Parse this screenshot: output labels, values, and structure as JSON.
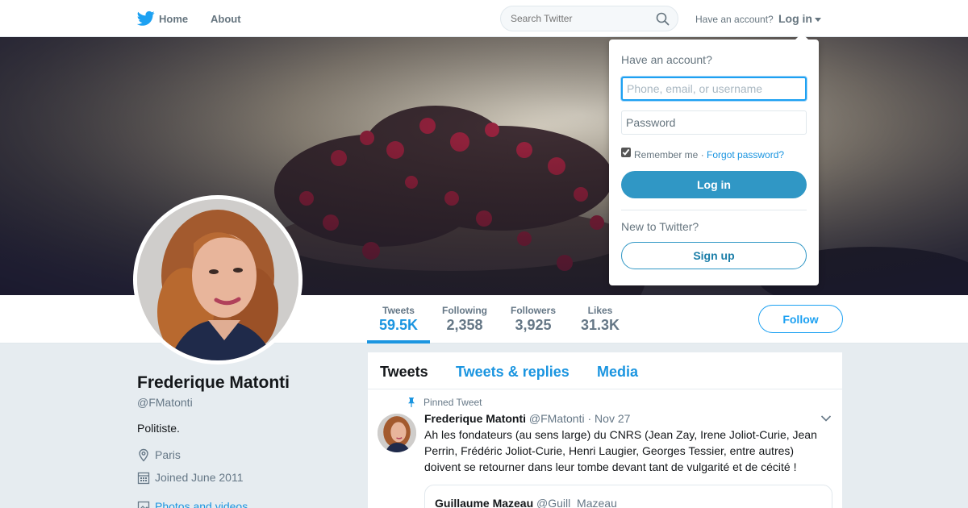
{
  "colors": {
    "brand": "#1da1f2",
    "link": "#1b95e0",
    "button": "#3097c5"
  },
  "topnav": {
    "home_label": "Home",
    "about_label": "About",
    "search_placeholder": "Search Twitter",
    "have_account": "Have an account?",
    "login_label": "Log in"
  },
  "profile_nav": {
    "stats": [
      {
        "label": "Tweets",
        "value": "59.5K"
      },
      {
        "label": "Following",
        "value": "2,358"
      },
      {
        "label": "Followers",
        "value": "3,925"
      },
      {
        "label": "Likes",
        "value": "31.3K"
      }
    ],
    "follow_label": "Follow"
  },
  "profile": {
    "name": "Frederique Matonti",
    "handle": "@FMatonti",
    "bio": "Politiste.",
    "location": "Paris",
    "joined": "Joined June 2011",
    "photos_link": "Photos and videos"
  },
  "timeline": {
    "tabs": [
      "Tweets",
      "Tweets & replies",
      "Media"
    ],
    "pinned_label": "Pinned Tweet",
    "tweet": {
      "name": "Frederique Matonti",
      "handle": "@FMatonti",
      "separator": "·",
      "date": "Nov 27",
      "text": "Ah les fondateurs (au sens large) du CNRS (Jean Zay, Irene Joliot-Curie, Jean Perrin, Frédéric Joliot-Curie, Henri Laugier, Georges Tessier, entre autres) doivent se retourner dans leur tombe devant tant de vulgarité et de cécité !"
    },
    "quote": {
      "name": "Guillaume Mazeau",
      "handle": "@Guill_Mazeau"
    }
  },
  "login_dropdown": {
    "title": "Have an account?",
    "username_placeholder": "Phone, email, or username",
    "password_placeholder": "Password",
    "remember_label": "Remember me",
    "separator": " · ",
    "forgot_label": "Forgot password?",
    "login_button": "Log in",
    "new_to": "New to Twitter?",
    "signup_button": "Sign up"
  }
}
